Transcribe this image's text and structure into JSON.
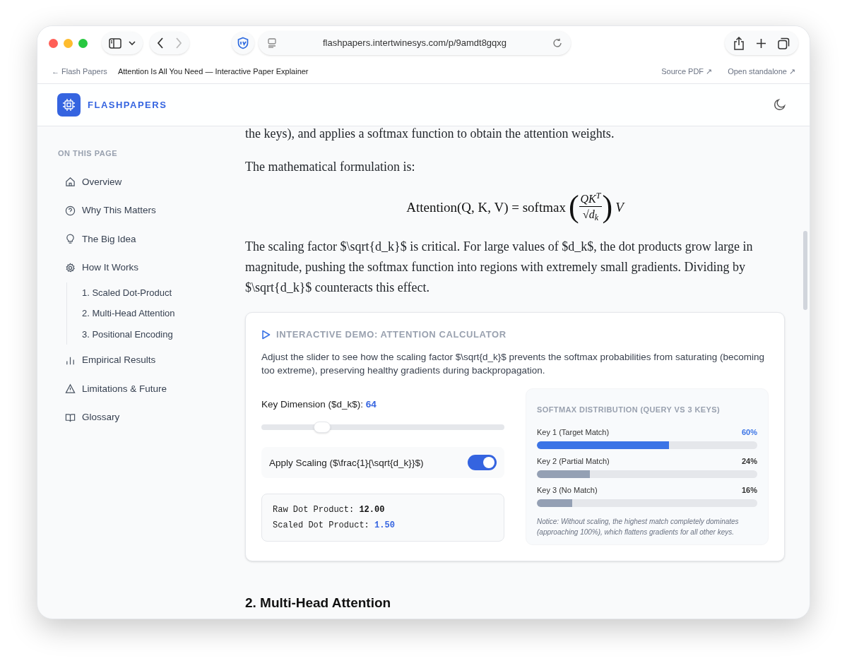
{
  "browser": {
    "url": "flashpapers.intertwinesys.com/p/9amdt8gqxg",
    "back_label": "← Flash Papers",
    "page_title": "Attention Is All You Need — Interactive Paper Explainer",
    "links": [
      "Source PDF ↗",
      "Open standalone ↗"
    ]
  },
  "app": {
    "logo_text": "FLASHPAPERS"
  },
  "sidebar": {
    "heading": "ON THIS PAGE",
    "items": [
      {
        "label": "Overview",
        "selected": false
      },
      {
        "label": "Why This Matters",
        "selected": false
      },
      {
        "label": "The Big Idea",
        "selected": false
      },
      {
        "label": "How It Works",
        "selected": false,
        "children": [
          {
            "label": "1. Scaled Dot-Product",
            "selected": false
          },
          {
            "label": "2. Multi-Head Attention",
            "selected": false
          },
          {
            "label": "3. Positional Encoding",
            "selected": false
          }
        ]
      },
      {
        "label": "Empirical Results",
        "selected": false
      },
      {
        "label": "Limitations & Future",
        "selected": false
      },
      {
        "label": "Glossary",
        "selected": false
      }
    ]
  },
  "article": {
    "paragraphs_before": [
      "the keys), and applies a softmax function to obtain the attention weights.",
      "The mathematical formulation is:"
    ],
    "formula": {
      "lhs": "Attention(Q, K, V) = softmax",
      "open_paren": "(",
      "numerator": "QK$^{T}$",
      "denominator": "√d$_{k}$",
      "close_paren": ")",
      "rhs": "V"
    },
    "paragraphs_after": [
      "The scaling factor $\\sqrt{d_k}$ is critical. For large values of $d_k$, the dot products grow large in magnitude, pushing the softmax function into regions with extremely small gradients. Dividing by $\\sqrt{d_k}$ counteracts this effect."
    ],
    "next_heading": "2. Multi-Head Attention"
  },
  "demo": {
    "title": "INTERACTIVE DEMO: ATTENTION CALCULATOR",
    "description": "Adjust the slider to see how the scaling factor $\\sqrt{d_k}$ prevents the softmax probabilities from saturating (becoming too extreme), preserving healthy gradients during backpropagation.",
    "slider": {
      "label": "Key Dimension ($d_k$):",
      "value": "64",
      "level": 0.25
    },
    "toggle": {
      "label": "Apply Scaling ($\\frac{1}{\\sqrt{d_k}}$)",
      "on": true
    },
    "results": [
      {
        "label": "Raw Dot Product:",
        "value": "12.00",
        "highlight": false
      },
      {
        "label": "Scaled Dot Product:",
        "value": "1.50",
        "highlight": true
      }
    ],
    "distribution": {
      "title": "SOFTMAX DISTRIBUTION (QUERY VS 3 KEYS)",
      "keys": [
        {
          "label": "Key 1 (Target Match)",
          "reading": "60%",
          "level": 0.6,
          "color": "#3b74e6"
        },
        {
          "label": "Key 2 (Partial Match)",
          "reading": "24%",
          "level": 0.24,
          "color": "#94a0b4"
        },
        {
          "label": "Key 3 (No Match)",
          "reading": "16%",
          "level": 0.16,
          "color": "#94a0b4"
        }
      ],
      "note": "Notice: Without scaling, the highest match completely dominates (approaching 100%), which flattens gradients for all other keys."
    }
  }
}
